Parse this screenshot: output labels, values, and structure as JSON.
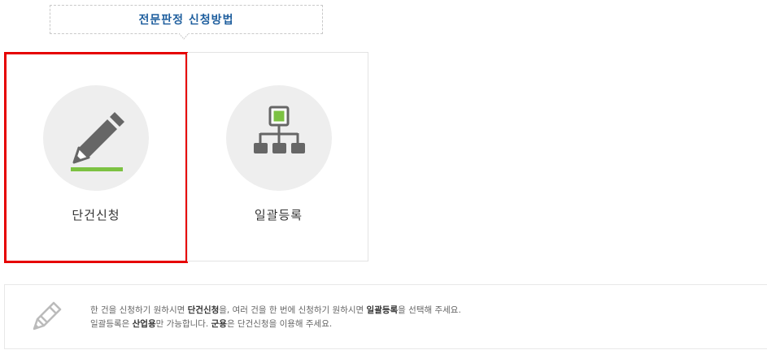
{
  "title": "전문판정 신청방법",
  "options": [
    {
      "label": "단건신청",
      "icon": "pencil-icon",
      "selected": true
    },
    {
      "label": "일괄등록",
      "icon": "hierarchy-icon",
      "selected": false
    }
  ],
  "notice": {
    "line1": {
      "p1": "한 건을 신청하기 원하시면 ",
      "b1": "단건신청",
      "p2": "을, 여러 건을 한 번에 신청하기 원하시면 ",
      "b2": "일괄등록",
      "p3": "을 선택해 주세요."
    },
    "line2": {
      "p1": "일괄등록은 ",
      "b1": "산업용",
      "p2": "만 가능합니다. ",
      "b2": "군용",
      "p3": "은 단건신청을 이용해 주세요."
    }
  },
  "colors": {
    "title": "#1f5f9e",
    "selected_border": "#e60000",
    "accent_green": "#7cc242",
    "icon_gray": "#666666"
  }
}
